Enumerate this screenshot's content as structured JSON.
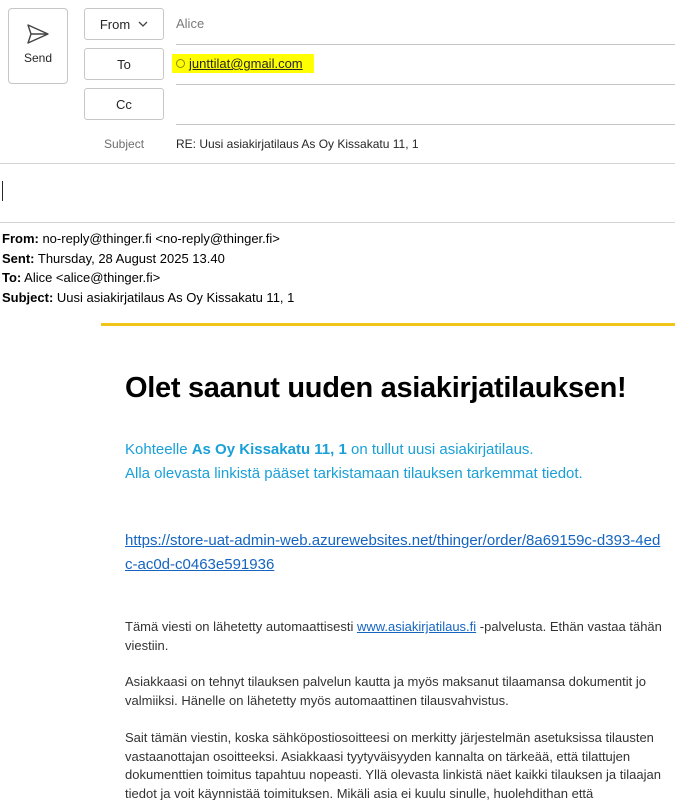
{
  "compose": {
    "send_label": "Send",
    "from_button_label": "From",
    "from_value": "Alice",
    "to_button_label": "To",
    "to_recipient": "junttilat@gmail.com",
    "cc_button_label": "Cc",
    "subject_label": "Subject",
    "subject_value": "RE: Uusi asiakirjatilaus As Oy Kissakatu 11, 1",
    "highlight_color": "#ffff00"
  },
  "original": {
    "from_label": "From:",
    "from_value": " no-reply@thinger.fi <no-reply@thinger.fi>",
    "sent_label": "Sent:",
    "sent_value": " Thursday, 28 August 2025 13.40",
    "to_label": "To:",
    "to_value": " Alice <alice@thinger.fi>",
    "subject_label": "Subject:",
    "subject_value": " Uusi asiakirjatilaus As Oy Kissakatu 11, 1"
  },
  "body": {
    "accent_color": "#f0c419",
    "headline": "Olet saanut uuden asiakirjatilauksen!",
    "line1_prefix": "Kohteelle ",
    "line1_bold": "As Oy Kissakatu 11, 1",
    "line1_suffix": " on tullut uusi asiakirjatilaus.",
    "line2": "Alla olevasta linkistä pääset tarkistamaan tilauksen tarkemmat tiedot.",
    "order_link": "https://store-uat-admin-web.azurewebsites.net/thinger/order/8a69159c-d393-4edc-ac0d-c0463e591936",
    "para1_prefix": "Tämä viesti on lähetetty automaattisesti ",
    "para1_link": "www.asiakirjatilaus.fi",
    "para1_suffix": " -palvelusta. Ethän vastaa tähän viestiin.",
    "para2": "Asiakkaasi on tehnyt tilauksen palvelun kautta ja myös maksanut tilaamansa dokumentit jo valmiiksi. Hänelle on lähetetty myös automaattinen tilausvahvistus.",
    "para3": "Sait tämän viestin, koska sähköpostiosoitteesi on merkitty järjestelmän asetuksissa tilausten vastaanottajan osoitteeksi. Asiakkaasi tyytyväisyyden kannalta on tärkeää, että tilattujen dokumenttien toimitus tapahtuu nopeasti. Yllä olevasta linkistä näet kaikki tilauksen ja tilaajan tiedot ja voit käynnistää toimituksen. Mikäli asia ei kuulu sinulle, huolehdithan että"
  }
}
